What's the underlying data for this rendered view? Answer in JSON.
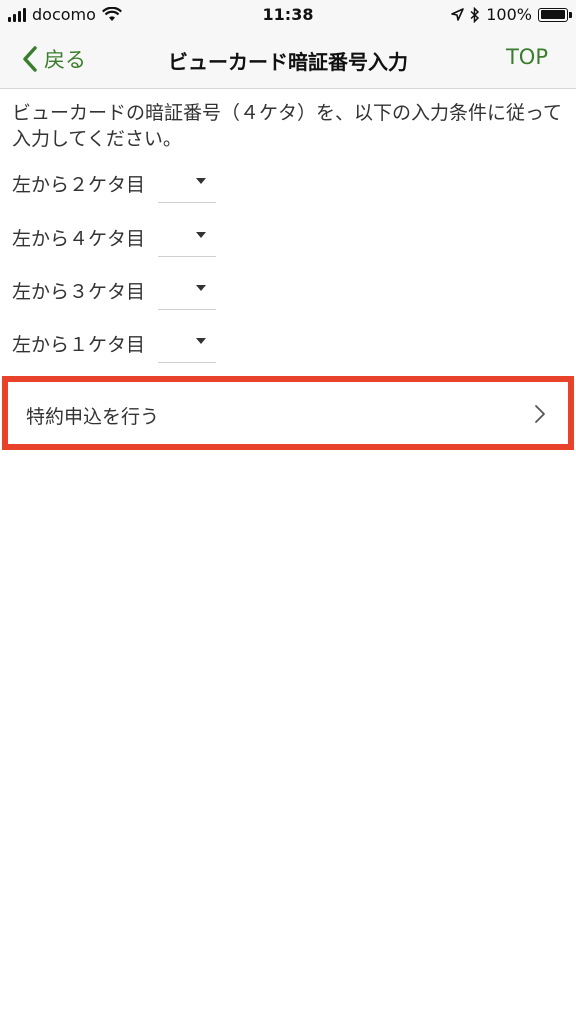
{
  "status_bar": {
    "carrier": "docomo",
    "time": "11:38",
    "battery_percent": "100%",
    "battery_level": 1.0
  },
  "nav": {
    "back_label": "戻る",
    "title": "ビューカード暗証番号入力",
    "top_label": "TOP"
  },
  "intro": "ビューカードの暗証番号（４ケタ）を、以下の入力条件に従って入力してください。",
  "digit_rows": [
    {
      "label": "左から２ケタ目",
      "value": ""
    },
    {
      "label": "左から４ケタ目",
      "value": ""
    },
    {
      "label": "左から３ケタ目",
      "value": ""
    },
    {
      "label": "左から１ケタ目",
      "value": ""
    }
  ],
  "special_button": {
    "label": "特約申込を行う"
  },
  "colors": {
    "accent_green": "#3a7d2c",
    "highlight_red": "#e8432a"
  }
}
